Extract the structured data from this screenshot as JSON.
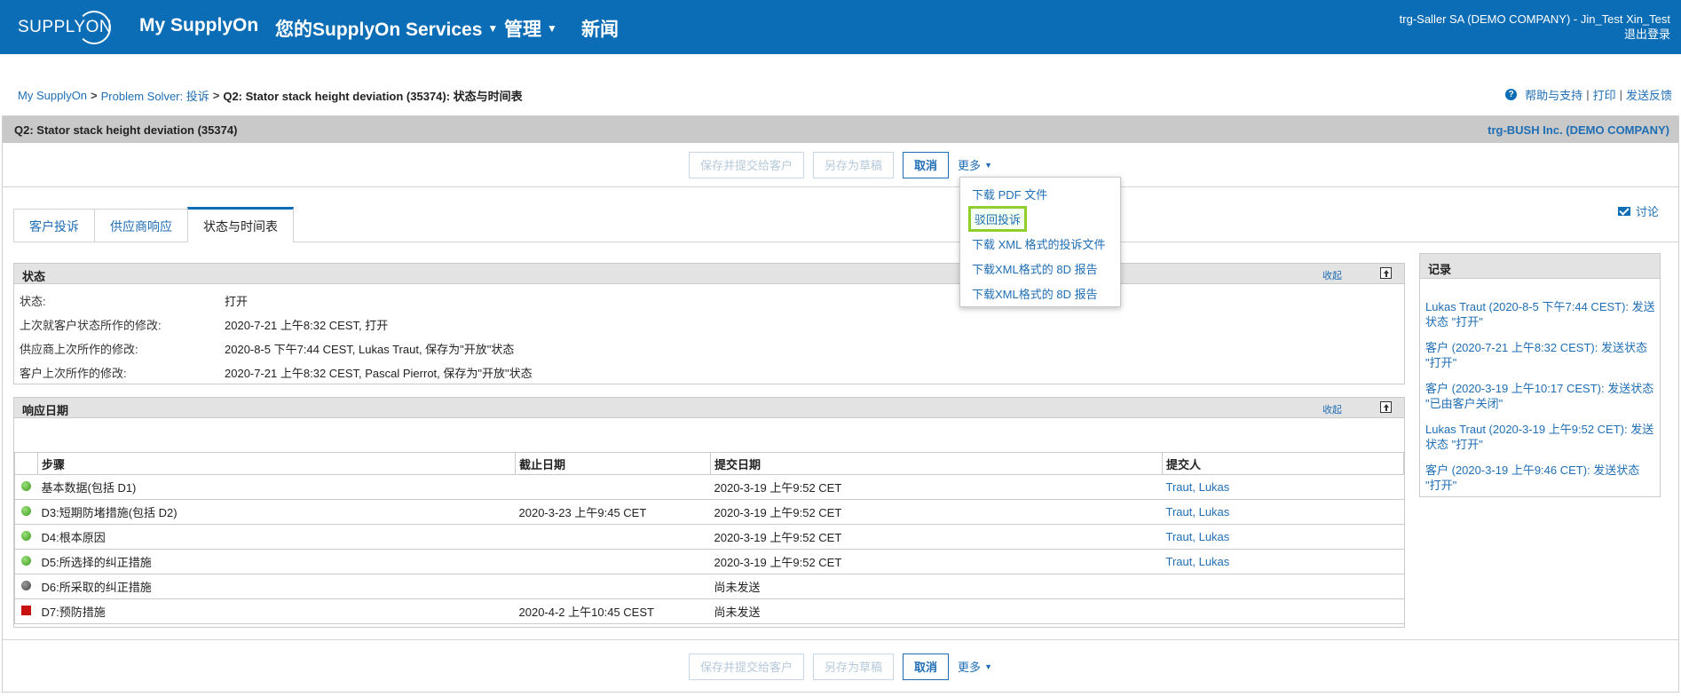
{
  "header": {
    "logo_text": "SUPPLYON",
    "nav": [
      {
        "label": "My SupplyOn",
        "has_caret": false
      },
      {
        "label": "您的SupplyOn Services",
        "has_caret": true
      },
      {
        "label": "管理",
        "has_caret": true
      },
      {
        "label": "新闻",
        "has_caret": false
      }
    ],
    "user": "trg-Saller SA (DEMO COMPANY) - Jin_Test Xin_Test",
    "logout": "退出登录"
  },
  "breadcrumb": {
    "items": [
      "My SupplyOn",
      "Problem Solver: 投诉"
    ],
    "separator": ">",
    "current": "Q2: Stator stack height deviation (35374): 状态与时间表"
  },
  "help": {
    "help_support": "帮助与支持",
    "print": "打印",
    "feedback": "发送反馈",
    "divider": "|"
  },
  "title_bar": {
    "title": "Q2: Stator stack height deviation (35374)",
    "company": "trg-BUSH Inc. (DEMO COMPANY)"
  },
  "toolbar": {
    "submit": "保存并提交给客户",
    "save_draft": "另存为草稿",
    "cancel": "取消",
    "more": "更多"
  },
  "more_menu": {
    "items": [
      "下载 PDF 文件",
      "驳回投诉",
      "下载 XML 格式的投诉文件",
      "下载XML格式的 8D 报告",
      "下载XML格式的 8D 报告"
    ]
  },
  "tabs": [
    {
      "label": "客户投诉",
      "active": false
    },
    {
      "label": "供应商响应",
      "active": false
    },
    {
      "label": "状态与时间表",
      "active": true
    }
  ],
  "discuss": "讨论",
  "status_panel": {
    "title": "状态",
    "collapse": "收起",
    "rows": [
      {
        "label": "状态:",
        "value": "打开"
      },
      {
        "label": "上次就客户状态所作的修改:",
        "value": "2020-7-21 上午8:32 CEST, 打开"
      },
      {
        "label": "供应商上次所作的修改:",
        "value": "2020-8-5 下午7:44 CEST, Lukas Traut, 保存为\"开放\"状态"
      },
      {
        "label": "客户上次所作的修改:",
        "value": "2020-7-21 上午8:32 CEST, Pascal Pierrot, 保存为\"开放\"状态"
      }
    ]
  },
  "response_panel": {
    "title": "响应日期",
    "collapse": "收起",
    "columns": [
      "步骤",
      "截止日期",
      "提交日期",
      "提交人"
    ],
    "rows": [
      {
        "indicator": "green",
        "step": "基本数据(包括 D1)",
        "due": "",
        "submitted": "2020-3-19 上午9:52 CET",
        "by": "Traut, Lukas"
      },
      {
        "indicator": "green",
        "step": "D3:短期防堵措施(包括 D2)",
        "due": "2020-3-23 上午9:45 CET",
        "submitted": "2020-3-19 上午9:52 CET",
        "by": "Traut, Lukas"
      },
      {
        "indicator": "green",
        "step": "D4:根本原因",
        "due": "",
        "submitted": "2020-3-19 上午9:52 CET",
        "by": "Traut, Lukas"
      },
      {
        "indicator": "green",
        "step": "D5:所选择的纠正措施",
        "due": "",
        "submitted": "2020-3-19 上午9:52 CET",
        "by": "Traut, Lukas"
      },
      {
        "indicator": "grey",
        "step": "D6:所采取的纠正措施",
        "due": "",
        "submitted": "尚未发送",
        "by": ""
      },
      {
        "indicator": "red",
        "step": "D7:预防措施",
        "due": "2020-4-2 上午10:45 CEST",
        "submitted": "尚未发送",
        "by": ""
      }
    ]
  },
  "history_panel": {
    "title": "记录",
    "items": [
      "Lukas Traut (2020-8-5 下午7:44 CEST): 发送状态 \"打开\"",
      "客户 (2020-7-21 上午8:32 CEST): 发送状态 \"打开\"",
      "客户 (2020-3-19 上午10:17 CEST): 发送状态 \"已由客户关闭\"",
      "Lukas Traut (2020-3-19 上午9:52 CET): 发送状态 \"打开\"",
      "客户 (2020-3-19 上午9:46 CET): 发送状态 \"打开\""
    ]
  },
  "colors": {
    "brand_blue": "#0b6db6",
    "link_blue": "#1f6eb5",
    "highlight": "#8ecf2e"
  }
}
